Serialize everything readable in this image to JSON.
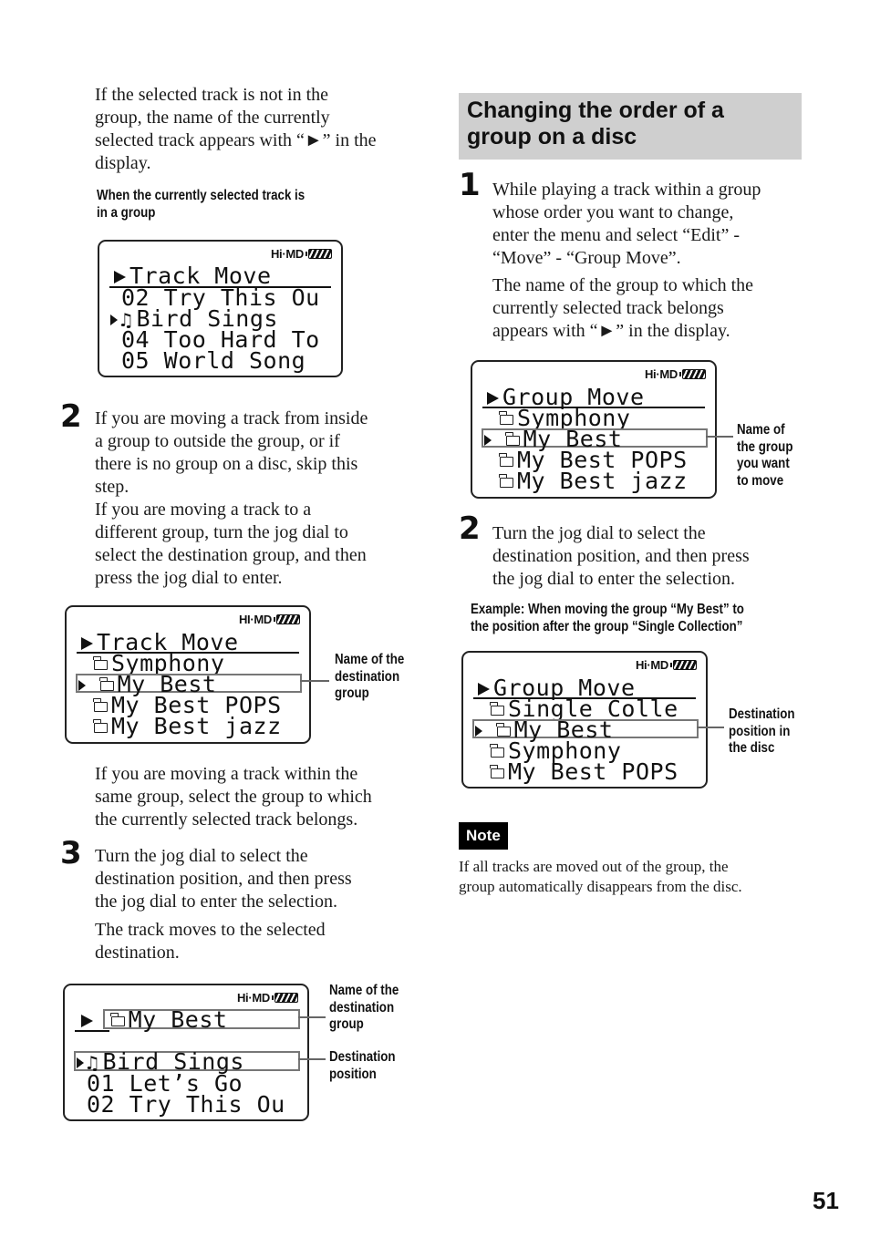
{
  "page_number": "51",
  "left_column": {
    "intro_paragraph": [
      "If the selected track is not in the",
      "group, the name of the currently",
      "selected track appears with “►” in the",
      "display."
    ],
    "caption_1": [
      "When the currently selected track is",
      "in a group"
    ],
    "display_1": {
      "status": "Hi·MD",
      "title": "Track Move",
      "rows": [
        {
          "text": "02 Try This Ou",
          "marker": "",
          "icon": ""
        },
        {
          "text": "Bird Sings",
          "marker": "selected",
          "icon": "music-note"
        },
        {
          "text": "04 Too Hard To",
          "marker": "",
          "icon": ""
        },
        {
          "text": "05 World Song",
          "marker": "",
          "icon": ""
        }
      ]
    },
    "step_2": {
      "number": "2",
      "paragraph": [
        "If you are moving a track from inside",
        "a group to outside the group, or if",
        "there is no group on a disc, skip this",
        "step.",
        "If you are moving a track to a",
        "different group, turn the jog dial to",
        "select the destination group, and then",
        "press the jog dial to enter."
      ]
    },
    "display_2": {
      "status": "HI·MD",
      "title": "Track Move",
      "rows": [
        {
          "text": "Symphony",
          "icon": "folder"
        },
        {
          "text": "My Best",
          "icon": "folder",
          "marker": "selected"
        },
        {
          "text": "My Best POPS",
          "icon": "folder"
        },
        {
          "text": "My Best jazz",
          "icon": "folder"
        }
      ],
      "callout": [
        "Name of the",
        "destination",
        "group"
      ]
    },
    "same_group_paragraph": [
      "If you are moving a track within the",
      "same group, select the group to which",
      "the currently selected track belongs."
    ],
    "step_3": {
      "number": "3",
      "paragraph": [
        "Turn the jog dial to select the",
        "destination position, and then press",
        "the jog dial to enter the selection."
      ],
      "result": [
        "The track moves to the selected",
        "destination."
      ]
    },
    "display_3": {
      "status": "Hi·MD",
      "title": "My Best",
      "rows": [
        {
          "text": "Bird Sings",
          "icon": "music-note",
          "marker": "selected"
        },
        {
          "text": "01 Let’s Go"
        },
        {
          "text": "02 Try This Ou"
        }
      ],
      "callout_1": [
        "Name of the",
        "destination",
        "group"
      ],
      "callout_2": [
        "Destination",
        "position"
      ]
    }
  },
  "right_column": {
    "section_heading": [
      "Changing the order of a",
      "group on a disc"
    ],
    "step_1": {
      "number": "1",
      "paragraph": [
        "While playing a track within a group",
        "whose order you want to change,",
        "enter the menu and select “Edit” -",
        "“Move” - “Group Move”."
      ],
      "paragraph_2": [
        "The name of the group to which the",
        "currently selected track belongs",
        "appears with “►” in the display."
      ]
    },
    "display_4": {
      "status": "Hi·MD",
      "title": "Group Move",
      "rows": [
        {
          "text": "Symphony",
          "icon": "folder"
        },
        {
          "text": "My Best",
          "icon": "folder",
          "marker": "selected"
        },
        {
          "text": "My Best POPS",
          "icon": "folder"
        },
        {
          "text": "My Best jazz",
          "icon": "folder"
        }
      ],
      "callout": [
        "Name of",
        "the group",
        "you want",
        "to move"
      ]
    },
    "step_2": {
      "number": "2",
      "paragraph": [
        "Turn the jog dial to select the",
        "destination position, and then press",
        "the jog dial to enter the selection."
      ]
    },
    "example_caption": [
      "Example: When moving the group “My Best” to",
      "the position after the group “Single Collection”"
    ],
    "display_5": {
      "status": "Hi·MD",
      "title": "Group Move",
      "rows": [
        {
          "text": "Single Colle",
          "icon": "folder"
        },
        {
          "text": "My Best",
          "icon": "folder",
          "marker": "selected"
        },
        {
          "text": "Symphony",
          "icon": "folder"
        },
        {
          "text": "My Best POPS",
          "icon": "folder"
        }
      ],
      "callout": [
        "Destination",
        "position in",
        "the disc"
      ]
    },
    "note": {
      "label": "Note",
      "text": [
        "If all tracks are moved out of the group, the",
        "group automatically disappears from the disc."
      ]
    }
  }
}
